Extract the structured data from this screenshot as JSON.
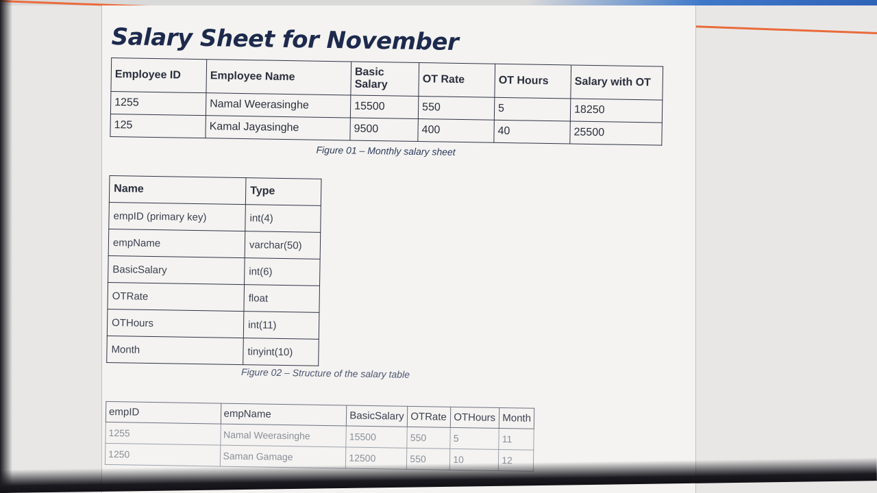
{
  "title": "Salary Sheet for November",
  "salary_sheet": {
    "headers": [
      "Employee ID",
      "Employee Name",
      "Basic Salary",
      "OT Rate",
      "OT Hours",
      "Salary with OT"
    ],
    "rows": [
      [
        "1255",
        "Namal Weerasinghe",
        "15500",
        "550",
        "5",
        "18250"
      ],
      [
        "125",
        "Kamal Jayasinghe",
        "9500",
        "400",
        "40",
        "25500"
      ]
    ],
    "caption": "Figure 01 – Monthly salary sheet"
  },
  "structure_table": {
    "headers": [
      "Name",
      "Type"
    ],
    "rows": [
      [
        "empID  (primary key)",
        "int(4)"
      ],
      [
        "empName",
        "varchar(50)"
      ],
      [
        "BasicSalary",
        "int(6)"
      ],
      [
        "OTRate",
        "float"
      ],
      [
        "OTHours",
        "int(11)"
      ],
      [
        "Month",
        "tinyint(10)"
      ]
    ],
    "caption": "Figure 02 – Structure of the salary table"
  },
  "records_table": {
    "headers": [
      "empID",
      "empName",
      "BasicSalary",
      "OTRate",
      "OTHours",
      "Month"
    ],
    "rows": [
      [
        "1255",
        "Namal Weerasinghe",
        "15500",
        "550",
        "5",
        "11"
      ],
      [
        "1250",
        "Saman Gamage",
        "12500",
        "550",
        "10",
        "12"
      ]
    ]
  }
}
